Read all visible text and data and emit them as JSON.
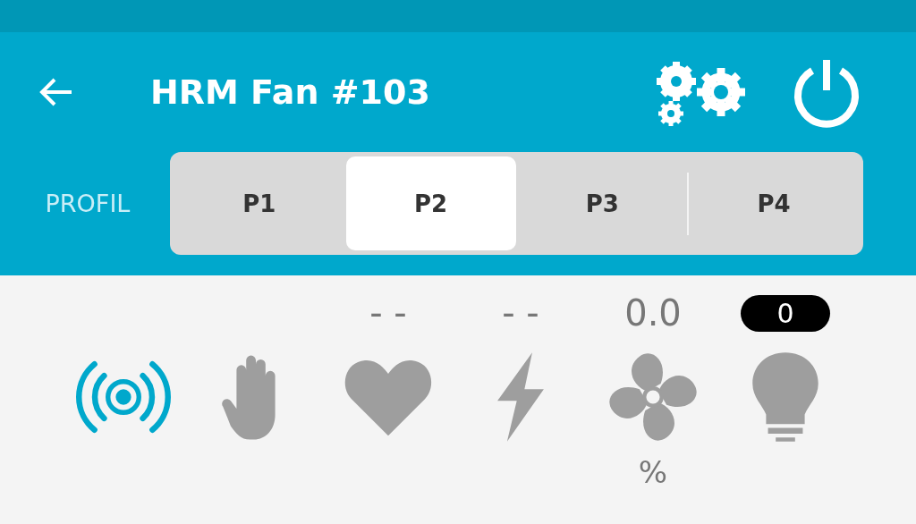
{
  "header": {
    "title": "HRM Fan #103"
  },
  "profile": {
    "label": "PROFIL",
    "tabs": [
      {
        "label": "P1",
        "selected": false
      },
      {
        "label": "P2",
        "selected": true
      },
      {
        "label": "P3",
        "selected": false
      },
      {
        "label": "P4",
        "selected": false
      }
    ]
  },
  "indicators": [
    {
      "kind": "signal",
      "active": true
    },
    {
      "kind": "hand",
      "active": false
    },
    {
      "kind": "heart",
      "active": false,
      "reading": "- -"
    },
    {
      "kind": "bolt",
      "active": false,
      "reading": "- -"
    },
    {
      "kind": "fan",
      "active": false,
      "reading": "0.0",
      "unit": "%"
    },
    {
      "kind": "bulb",
      "active": false,
      "badge": "0"
    }
  ]
}
